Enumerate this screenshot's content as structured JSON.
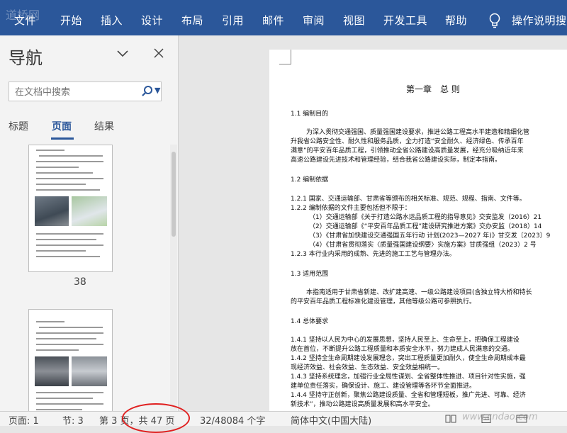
{
  "ribbon": {
    "watermark": "道桥网",
    "tabs": [
      "文件",
      "开始",
      "插入",
      "设计",
      "布局",
      "引用",
      "邮件",
      "审阅",
      "视图",
      "开发工具",
      "帮助"
    ],
    "tellme": "操作说明搜"
  },
  "nav": {
    "title": "导航",
    "search_placeholder": "在文档中搜索",
    "tabs": [
      "标题",
      "页面",
      "结果"
    ],
    "active_tab": "页面",
    "page_labels": [
      "38"
    ]
  },
  "document": {
    "chapter": "第一章　总 则",
    "lines": [
      "1.1 编制目的",
      "为深入贯彻交通强国、质量强国建设要求，推进公路工程高水平建造和精细化管",
      "升我省公路安全性、耐久性和服务品质，全力打造“安全耐久、经济绿色、传承百年",
      "满意”的平安百年品质工程，引领推动全省公路建设高质量发展，经充分吸纳近年来",
      "高速公路建设先进技术和管理经验，结合我省公路建设实际，制定本指南。",
      "1.2 编制依据",
      "1.2.1 国家、交通运输部、甘肃省等颁布的相关标准、规范、规程、指南、文件等。",
      "1.2.2 编制依据的文件主要包括但不限于：",
      "（1）交通运输部《关于打造公路水运品质工程的指导意见》交安监发（2016）21",
      "（2）交通运输部《“平安百年品质工程”建设研究推进方案》交办安监（2018）14",
      "（3）《甘肃省加快建设交通强国五年行动 计划(2023—2027 年)》甘交发〔2023〕9",
      "（4）《甘肃省贯彻落实〈质量强国建设纲要〉实施方案》甘质强组（2023）2 号",
      "1.2.3 本行业内采用的成熟、先进的施工工艺与管理办法。",
      "1.3 适用范围",
      "本指南适用于甘肃省新建、改扩建高速、一级公路建设项目(含独立特大桥和特长",
      "的平安百年品质工程标准化建设管理，其他等级公路可参照执行。",
      "1.4 总体要求",
      "1.4.1 坚持以人民为中心的发展思想，坚持人民至上、生命至上，把确保工程建设",
      "放在首位，不断提升公路工程质量和本质安全水平，努力建成人民满意的交通。",
      "1.4.2 坚持全生命周期建设发展理念，突出工程质量更加耐久，使全生命周期成本最",
      "现经济效益、社会效益、生态效益、安全效益相统一。",
      "1.4.3 坚持系统理念，加强行业全局性谋划、全省整体性推进、项目针对性实施，强",
      "建单位责任落实，确保设计、施工、建设管理等各环节全面推进。",
      "1.4.4 坚持守正创新，聚焦公路建设质量、全省和管理短板，推广先进、可靠、经济",
      "新技术”，推动公路建设高质量发展和高水平安全。"
    ]
  },
  "status": {
    "page": "页面: 1",
    "section": "节: 3",
    "of_page": "第 3 页，共 47 页",
    "words": "32/48084 个字",
    "language": "简体中文(中国大陆)",
    "watermark": "www.cndao.com"
  },
  "colors": {
    "ribbon": "#2b579a",
    "accent": "#2b579a",
    "highlight_circle": "#e02020"
  }
}
